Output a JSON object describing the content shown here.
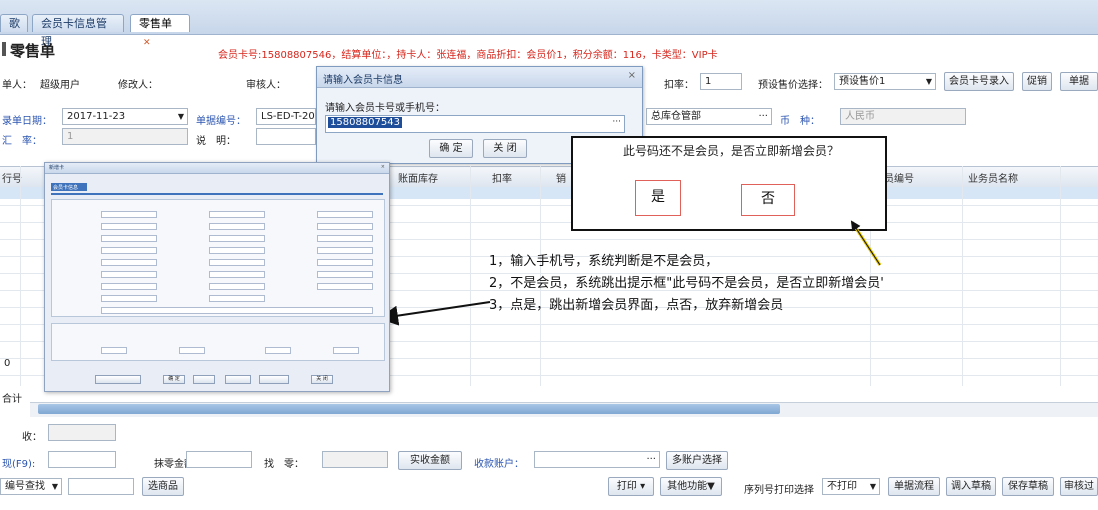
{
  "tabs": [
    {
      "label": "歌"
    },
    {
      "label": "会员卡信息管理"
    },
    {
      "label": "零售单"
    }
  ],
  "page_title": "零售单",
  "member_info": "会员卡号:15808807546，结算单位：，持卡人：张连福，商品折扣：会员价1，积分余额：116，卡类型：VIP卡",
  "form": {
    "creator_label": "单人：",
    "creator_value": "超级用户",
    "modifier_label": "修改人：",
    "auditor_label": "审核人：",
    "discount_label": "扣率：",
    "discount_value": "1",
    "price_select_label": "预设售价选择：",
    "price_select_value": "预设售价1",
    "btn_card_entry": "会员卡号录入",
    "btn_promo": "促销",
    "btn_single": "单据",
    "date_label": "录单日期：",
    "date_value": "2017-11-23",
    "docno_label": "单据编号：",
    "docno_value": "LS-ED-T-20",
    "warehouse_value": "总库仓管部",
    "currency_label": "币　种：",
    "currency_value": "人民币",
    "rate_label": "汇　率：",
    "rate_value": "1",
    "note_label": "说　明："
  },
  "dialog": {
    "title": "请输入会员卡信息",
    "prompt": "请输入会员卡号或手机号：",
    "value": "15808807543",
    "ok": "确 定",
    "close": "关 闭"
  },
  "callout": {
    "question": "此号码还不是会员，是否立即新增会员？",
    "yes": "是",
    "no": "否"
  },
  "annotations": [
    "1，输入手机号，系统判断是不是会员，",
    "2，不是会员，系统跳出提示框\"此号码不是会员，是否立即新增会员'",
    "3，点是，跳出新增会员界面，点否，放弃新增会员"
  ],
  "grid": {
    "headers": [
      "行号",
      "账面库存",
      "扣率",
      "销",
      "员编号",
      "业务员名称"
    ],
    "row_zero": "0",
    "total": "合计"
  },
  "bottom": {
    "receive_label": "收：",
    "f9_label": "现(F9):",
    "change_label": "找　零：",
    "extra_label": "抹零金额：",
    "actual_btn": "实收金额",
    "account_label": "收款账户：",
    "multi_btn": "多账户选择",
    "lookup_label": "编号查找",
    "select_btn": "选商品",
    "print_btn": "打印",
    "other_btn": "其他功能▼",
    "serial_label": "序列号打印选择",
    "serial_value": "不打印",
    "doc_flow_btn": "单据流程",
    "draft_in_btn": "调入草稿",
    "save_draft_btn": "保存草稿",
    "audit_btn": "审核过"
  },
  "embed": {
    "title": "新增卡",
    "tab": "会员卡信息",
    "ok": "确 定",
    "close": "关 闭"
  }
}
